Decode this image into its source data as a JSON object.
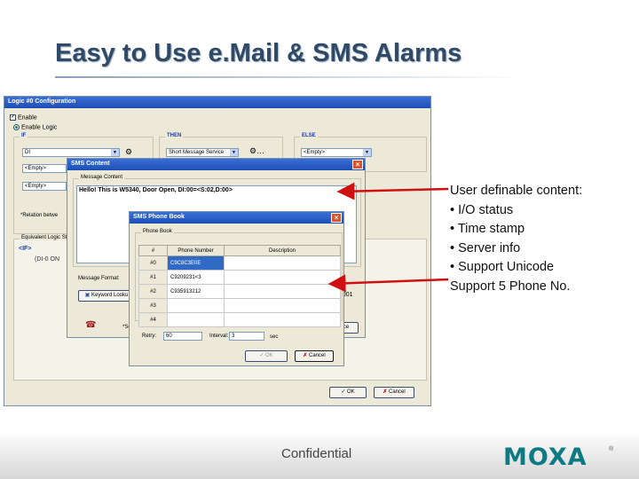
{
  "slide": {
    "title": "Easy to Use e.Mail & SMS Alarms",
    "callouts": [
      "User definable content:",
      "• I/O status",
      "• Time stamp",
      "• Server info",
      "• Support Unicode",
      "Support 5 Phone No."
    ],
    "footer": "Confidential",
    "logo": "MOXA",
    "logo_mark": "®"
  },
  "logic_window": {
    "title": "Logic #0 Configuration",
    "enable_label": "Enable",
    "enable_logic_label": "Enable Logic",
    "if_label": "IF",
    "then_label": "THEN",
    "else_label": "ELSE",
    "if_select": "DI",
    "if_empty1": "<Empty>",
    "if_empty2": "<Empty>",
    "then_select": "Short Message Service",
    "else_select": "<Empty>",
    "relation_label": "*Relation betwe",
    "equivalent_label": "Equivalent Logic St",
    "equiv_line1": "<IF>",
    "equiv_line2": "(DI-0 ON",
    "ok_label": "OK",
    "cancel_label": "Cancel"
  },
  "sms_window": {
    "title": "SMS Content",
    "message_content_label": "Message Content",
    "message_text": "Hello! This is W5340, Door Open, DI:00=<S:02,D:00>",
    "message_format_label": "Message Format:",
    "keyword_lookup_label": "Keyword Looku",
    "right_value": "2001",
    "se_label": "*Se",
    "ce_label": "ce"
  },
  "phonebook_window": {
    "title": "SMS Phone Book",
    "group_label": "Phone Book",
    "columns": [
      "#",
      "Phone Number",
      "Description"
    ],
    "rows": [
      {
        "idx": "#0",
        "number": "C9C8C3E0E",
        "desc": ""
      },
      {
        "idx": "#1",
        "number": "C9209231<3",
        "desc": ""
      },
      {
        "idx": "#2",
        "number": "C935913212",
        "desc": ""
      },
      {
        "idx": "#3",
        "number": "",
        "desc": ""
      },
      {
        "idx": "#4",
        "number": "",
        "desc": ""
      }
    ],
    "retry_label": "Retry:",
    "retry_value": "60",
    "interval_label": "Interval:",
    "interval_value": "3",
    "sec_label": "sec",
    "ok_label": "OK",
    "cancel_label": "Cancel"
  },
  "colors": {
    "title_text": "#2f4a66",
    "titlebar_blue": "#1d4fb3",
    "arrow_red": "#d01010",
    "logo_teal": "#0e7a84"
  }
}
